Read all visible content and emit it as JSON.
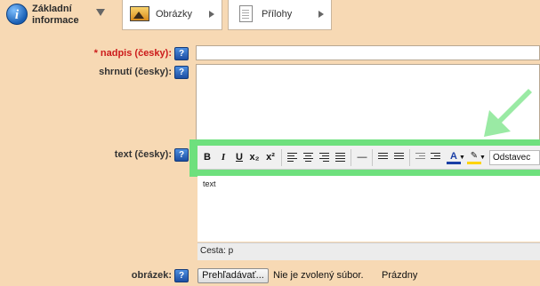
{
  "tabs": {
    "info": {
      "label": "Základní informace"
    },
    "images": {
      "label": "Obrázky"
    },
    "attachments": {
      "label": "Přílohy"
    }
  },
  "form": {
    "title": {
      "required_mark": "*",
      "label": "nadpis (česky):"
    },
    "summary": {
      "label": "shrnutí (česky):"
    },
    "text": {
      "label": "text (česky):"
    },
    "image": {
      "label": "obrázek:"
    },
    "help_glyph": "?"
  },
  "editor": {
    "buttons": {
      "bold": "B",
      "italic": "I",
      "underline": "U",
      "subscript": "x₂",
      "superscript": "x²",
      "hr": "—",
      "font_color": "A"
    },
    "format_select": "Odstavec",
    "content": "text",
    "path": "Cesta: p"
  },
  "file_upload": {
    "button_label": "Prehľadávať...",
    "status": "Nie je zvolený súbor.",
    "value": "Prázdny"
  },
  "colors": {
    "background": "#f7d9b4",
    "highlight": "#6ee07d",
    "required": "#cc1b1b",
    "help_button": "#1c4fa3"
  },
  "icons": {
    "info": "info-icon",
    "images": "image-icon",
    "attachments": "document-icon",
    "help": "help-icon",
    "annotation": "arrow-pointer-icon"
  }
}
